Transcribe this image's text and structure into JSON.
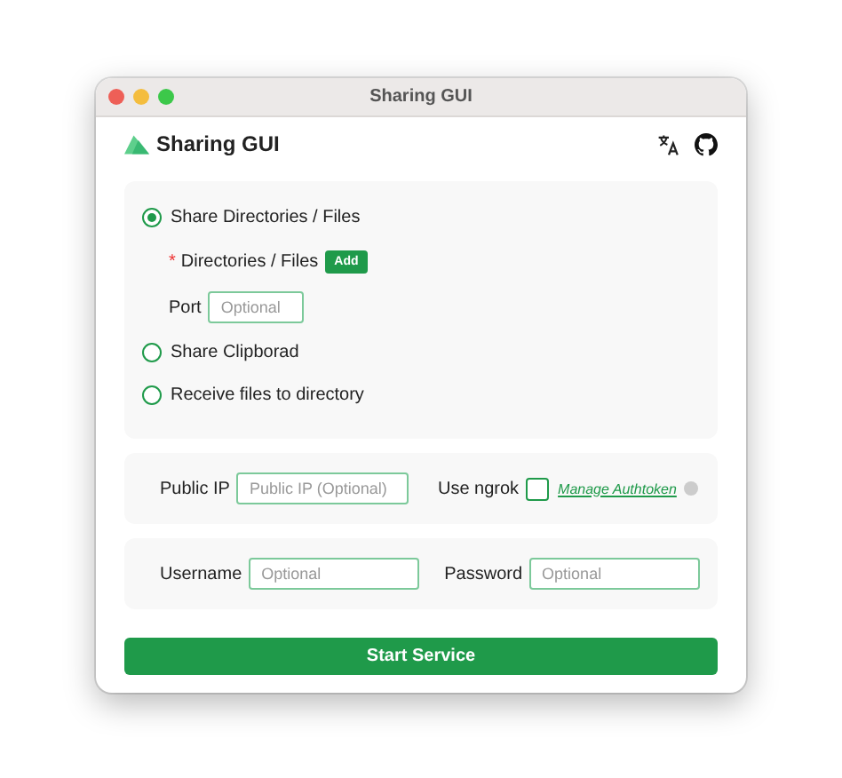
{
  "window": {
    "title": "Sharing GUI"
  },
  "app_title": "Sharing GUI",
  "modes": [
    {
      "label": "Share Directories / Files",
      "selected": true
    },
    {
      "label": "Share Clipborad",
      "selected": false
    },
    {
      "label": "Receive files to directory",
      "selected": false
    }
  ],
  "directories": {
    "label": "Directories / Files",
    "required_mark": "*",
    "add_button": "Add"
  },
  "port": {
    "label": "Port",
    "placeholder": "Optional"
  },
  "public_ip": {
    "label": "Public IP",
    "placeholder": "Public IP (Optional)"
  },
  "ngrok": {
    "label": "Use ngrok",
    "checked": false,
    "link": "Manage Authtoken"
  },
  "username": {
    "label": "Username",
    "placeholder": "Optional"
  },
  "password": {
    "label": "Password",
    "placeholder": "Optional"
  },
  "submit": "Start Service"
}
